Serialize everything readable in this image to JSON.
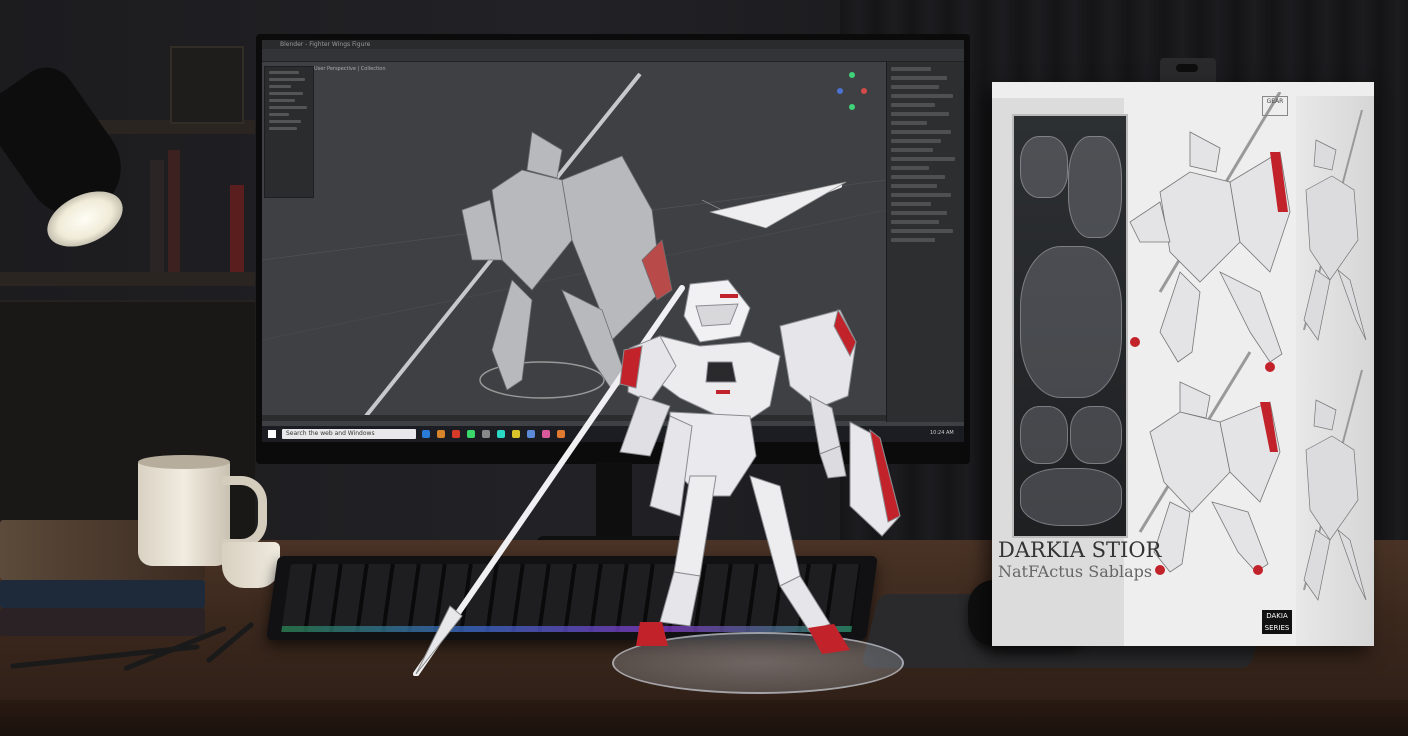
{
  "screen": {
    "app_title": "Blender - Fighter Wings Figure",
    "viewport_label": "User Perspective  |  Collection",
    "taskbar_search": "Search the web and Windows",
    "taskbar_clock": "10:24 AM"
  },
  "box": {
    "title": "DARKIA STIOR",
    "subtitle": "NatFActus Sablaps",
    "logo_small": "GEAR",
    "logo_brand": "DAKIA SERIES"
  },
  "colors": {
    "armor_white": "#e9e9ec",
    "armor_red": "#c2232b",
    "screen_bg": "#3f4043",
    "desk_wood": "#4a3326"
  },
  "icons": [
    "desk-lamp-icon",
    "monitor-icon",
    "keyboard-icon",
    "mouse-icon",
    "mug-icon",
    "book-icon"
  ]
}
